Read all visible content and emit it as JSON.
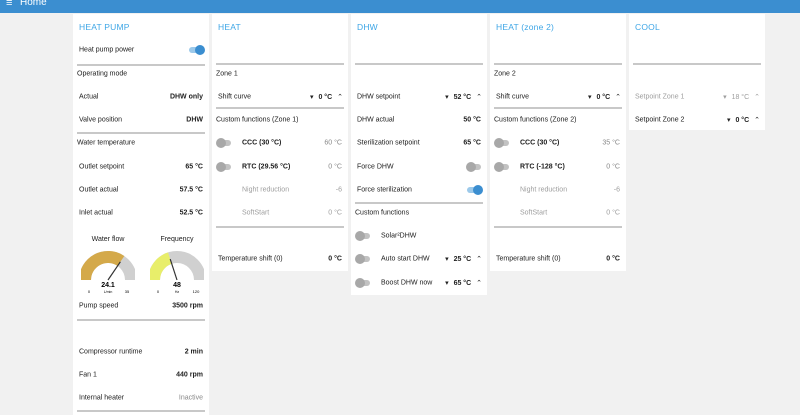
{
  "header": {
    "title": "Home",
    "menu_icon": "hamburger-menu-icon",
    "accent": "#3b8ed0"
  },
  "heat_pump": {
    "title": "HEAT PUMP",
    "power_label": "Heat pump power",
    "operating_mode_label": "Operating mode",
    "actual_label": "Actual",
    "actual_value": "DHW only",
    "valve_label": "Valve position",
    "valve_value": "DHW",
    "water_temp_label": "Water temperature",
    "outlet_setpoint_label": "Outlet setpoint",
    "outlet_setpoint_value": "65 °C",
    "outlet_actual_label": "Outlet actual",
    "outlet_actual_value": "57.5 °C",
    "inlet_actual_label": "Inlet actual",
    "inlet_actual_value": "52.5 °C",
    "water_flow": {
      "title": "Water flow",
      "value": "24.1",
      "unit": "L/min",
      "min": "0",
      "max": "35",
      "level": 0.69,
      "color": "#d4a94a"
    },
    "frequency": {
      "title": "Frequency",
      "value": "48",
      "unit": "Hz",
      "min": "0",
      "max": "120",
      "level": 0.4,
      "color": "#e8ee6a"
    },
    "pump_speed_label": "Pump speed",
    "pump_speed_value": "3500 rpm",
    "compressor_runtime_label": "Compressor runtime",
    "compressor_runtime_value": "2 min",
    "fan_label": "Fan 1",
    "fan_value": "440 rpm",
    "internal_heater_label": "Internal heater",
    "internal_heater_value": "Inactive"
  },
  "heat": {
    "title": "HEAT",
    "zone_label": "Zone 1",
    "shift_curve_label": "Shift curve",
    "shift_curve_value": "0 °C",
    "custom_functions_label": "Custom functions (Zone 1)",
    "ccc_label": "CCC",
    "ccc_temp": "(30 °C)",
    "ccc_value": "60 °C",
    "rtc_label": "RTC",
    "rtc_temp": "(29.56 °C)",
    "rtc_value": "0 °C",
    "night_reduction_label": "Night reduction",
    "night_reduction_value": "-6",
    "softstart_label": "SoftStart",
    "softstart_value": "0 °C",
    "temp_shift_label": "Temperature shift (0)",
    "temp_shift_value": "0 °C"
  },
  "dhw": {
    "title": "DHW",
    "setpoint_label": "DHW setpoint",
    "setpoint_value": "52 °C",
    "actual_label": "DHW actual",
    "actual_value": "50 °C",
    "sterilization_label": "Sterilization setpoint",
    "sterilization_value": "65 °C",
    "force_dhw_label": "Force DHW",
    "force_sterilization_label": "Force sterilization",
    "custom_functions_label": "Custom functions",
    "solar_label": "Solar²DHW",
    "auto_start_label": "Auto start DHW",
    "auto_start_value": "25 °C",
    "boost_label": "Boost DHW now",
    "boost_value": "65 °C"
  },
  "heat_zone2": {
    "title": "HEAT (zone 2)",
    "zone_label": "Zone 2",
    "shift_curve_label": "Shift curve",
    "shift_curve_value": "0 °C",
    "custom_functions_label": "Custom functions (Zone 2)",
    "ccc_label": "CCC",
    "ccc_temp": "(30 °C)",
    "ccc_value": "35 °C",
    "rtc_label": "RTC",
    "rtc_temp": "(-128 °C)",
    "rtc_value": "0 °C",
    "night_reduction_label": "Night reduction",
    "night_reduction_value": "-6",
    "softstart_label": "SoftStart",
    "softstart_value": "0 °C",
    "temp_shift_label": "Temperature shift (0)",
    "temp_shift_value": "0 °C"
  },
  "cool": {
    "title": "COOL",
    "setpoint_zone1_label": "Setpoint Zone 1",
    "setpoint_zone1_value": "18 °C",
    "setpoint_zone2_label": "Setpoint Zone 2",
    "setpoint_zone2_value": "0 °C"
  },
  "icons": {
    "dropdown": "▾",
    "stepper_up": "⌃"
  }
}
